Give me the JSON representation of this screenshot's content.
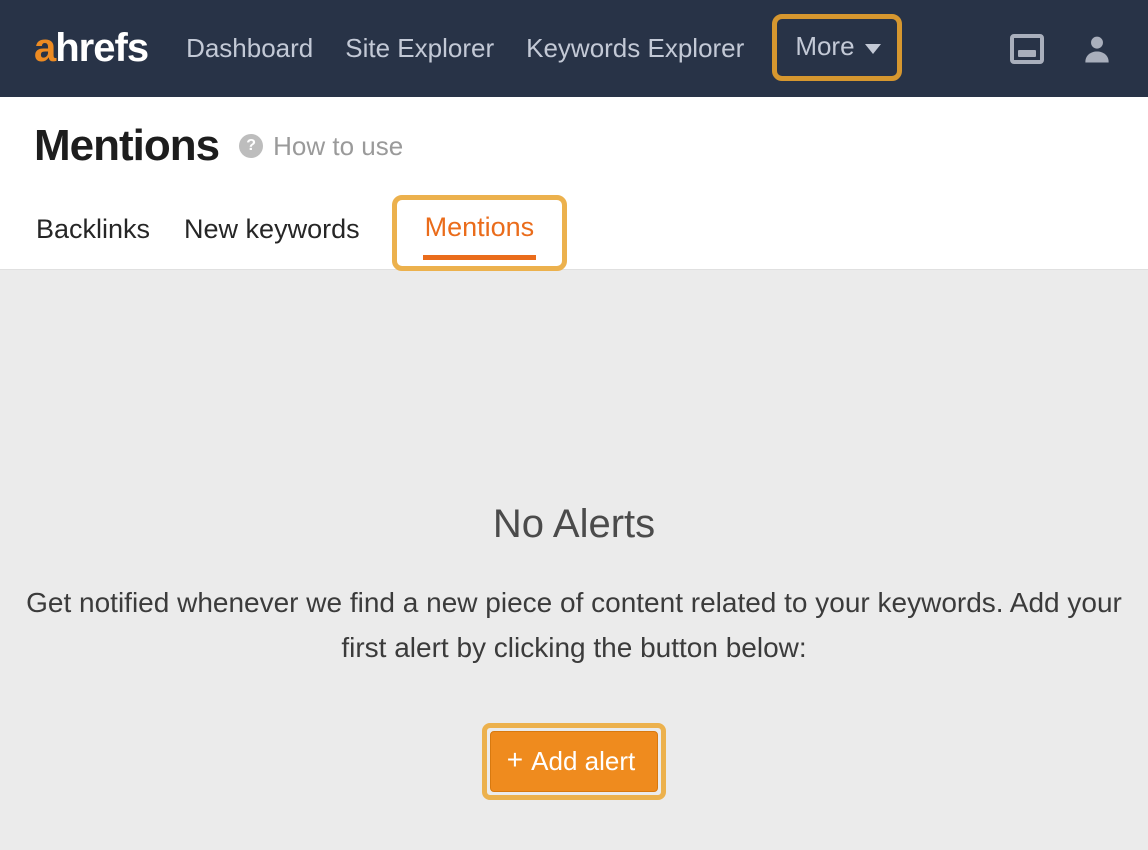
{
  "nav": {
    "logo": {
      "a": "a",
      "rest": "hrefs"
    },
    "items": [
      "Dashboard",
      "Site Explorer",
      "Keywords Explorer"
    ],
    "more": "More"
  },
  "header": {
    "title": "Mentions",
    "help": "How to use"
  },
  "tabs": [
    "Backlinks",
    "New keywords",
    "Mentions"
  ],
  "empty": {
    "heading": "No Alerts",
    "body": "Get notified whenever we find a new piece of content related to your keywords. Add your first alert by clicking the button below:",
    "button": "Add alert"
  }
}
